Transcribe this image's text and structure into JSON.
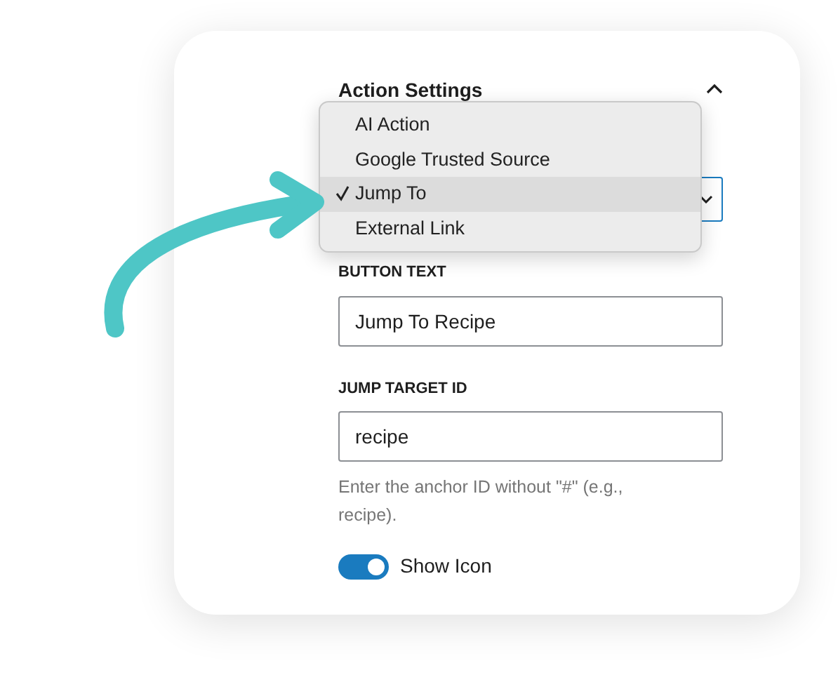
{
  "panel": {
    "title": "Action Settings",
    "expanded": true
  },
  "menu": {
    "items": [
      {
        "label": "AI Action",
        "selected": false
      },
      {
        "label": "Google Trusted Source",
        "selected": false
      },
      {
        "label": "Jump To",
        "selected": true
      },
      {
        "label": "External Link",
        "selected": false
      }
    ]
  },
  "fields": [
    {
      "label": "BUTTON TEXT",
      "value": "Jump To Recipe"
    },
    {
      "label": "JUMP TARGET ID",
      "value": "recipe",
      "help": "Enter the anchor ID without \"#\" (e.g., recipe)."
    }
  ],
  "toggle": {
    "label": "Show Icon",
    "on": true
  }
}
